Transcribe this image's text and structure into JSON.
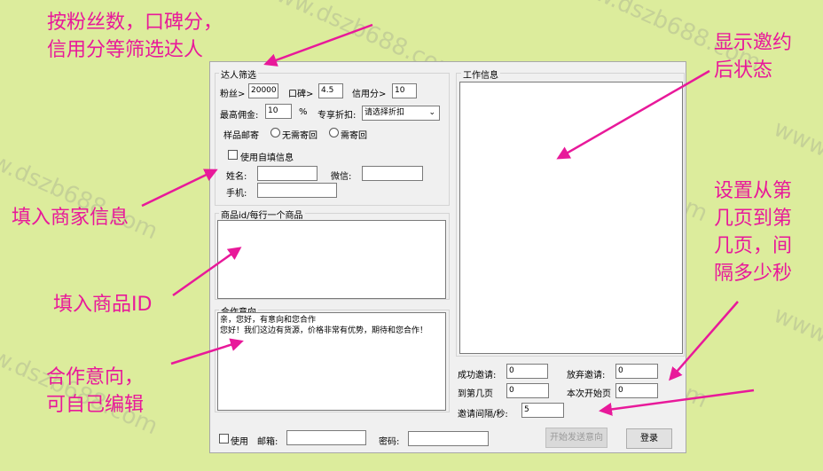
{
  "watermark": "www.dszb688.com",
  "annotations": {
    "filter": [
      "按粉丝数，口碑分，",
      "信用分等筛选达人"
    ],
    "status": [
      "显示邀约",
      "后状态"
    ],
    "merchant": [
      "填入商家信息"
    ],
    "product": [
      "填入商品ID"
    ],
    "intent": [
      "合作意向，",
      "可自己编辑"
    ],
    "paging": [
      "设置从第",
      "几页到第",
      "几页，间",
      "隔多少秒"
    ]
  },
  "filter": {
    "group_title": "达人筛选",
    "fans_label": "粉丝>",
    "fans_value": "20000",
    "reputation_label": "口碑>",
    "reputation_value": "4.5",
    "credit_label": "信用分>",
    "credit_value": "10",
    "commission_label": "最高佣金:",
    "commission_value": "10",
    "percent": "%",
    "discount_label": "专享折扣:",
    "discount_selected": "请选择折扣",
    "sample_label": "样品邮寄",
    "radio_no_return": "无需寄回",
    "radio_return": "需寄回",
    "use_custom_label": "使用自填信息",
    "name_label": "姓名:",
    "wechat_label": "微信:",
    "phone_label": "手机:"
  },
  "product": {
    "group_title": "商品id/每行一个商品",
    "value": ""
  },
  "intent": {
    "group_title": "合作意向",
    "value": "亲，您好，有意向和您合作\n您好！我们这边有货源，价格非常有优势，期待和您合作！"
  },
  "work": {
    "group_title": "工作信息",
    "log": ""
  },
  "stats": {
    "success_label": "成功邀请:",
    "success_value": "0",
    "abandon_label": "放弃邀请:",
    "abandon_value": "0",
    "to_page_label": "到第几页",
    "to_page_value": "0",
    "start_page_label": "本次开始页",
    "start_page_value": "0",
    "interval_label": "邀请间隔/秒:",
    "interval_value": "5"
  },
  "footer": {
    "use_label": "使用",
    "email_label": "邮箱:",
    "email_value": "",
    "password_label": "密码:",
    "password_value": "",
    "send_button": "开始发送意向",
    "login_button": "登录"
  },
  "colors": {
    "background": "#dcec9c",
    "annotation": "#e8199a",
    "window": "#f0f0f0"
  }
}
